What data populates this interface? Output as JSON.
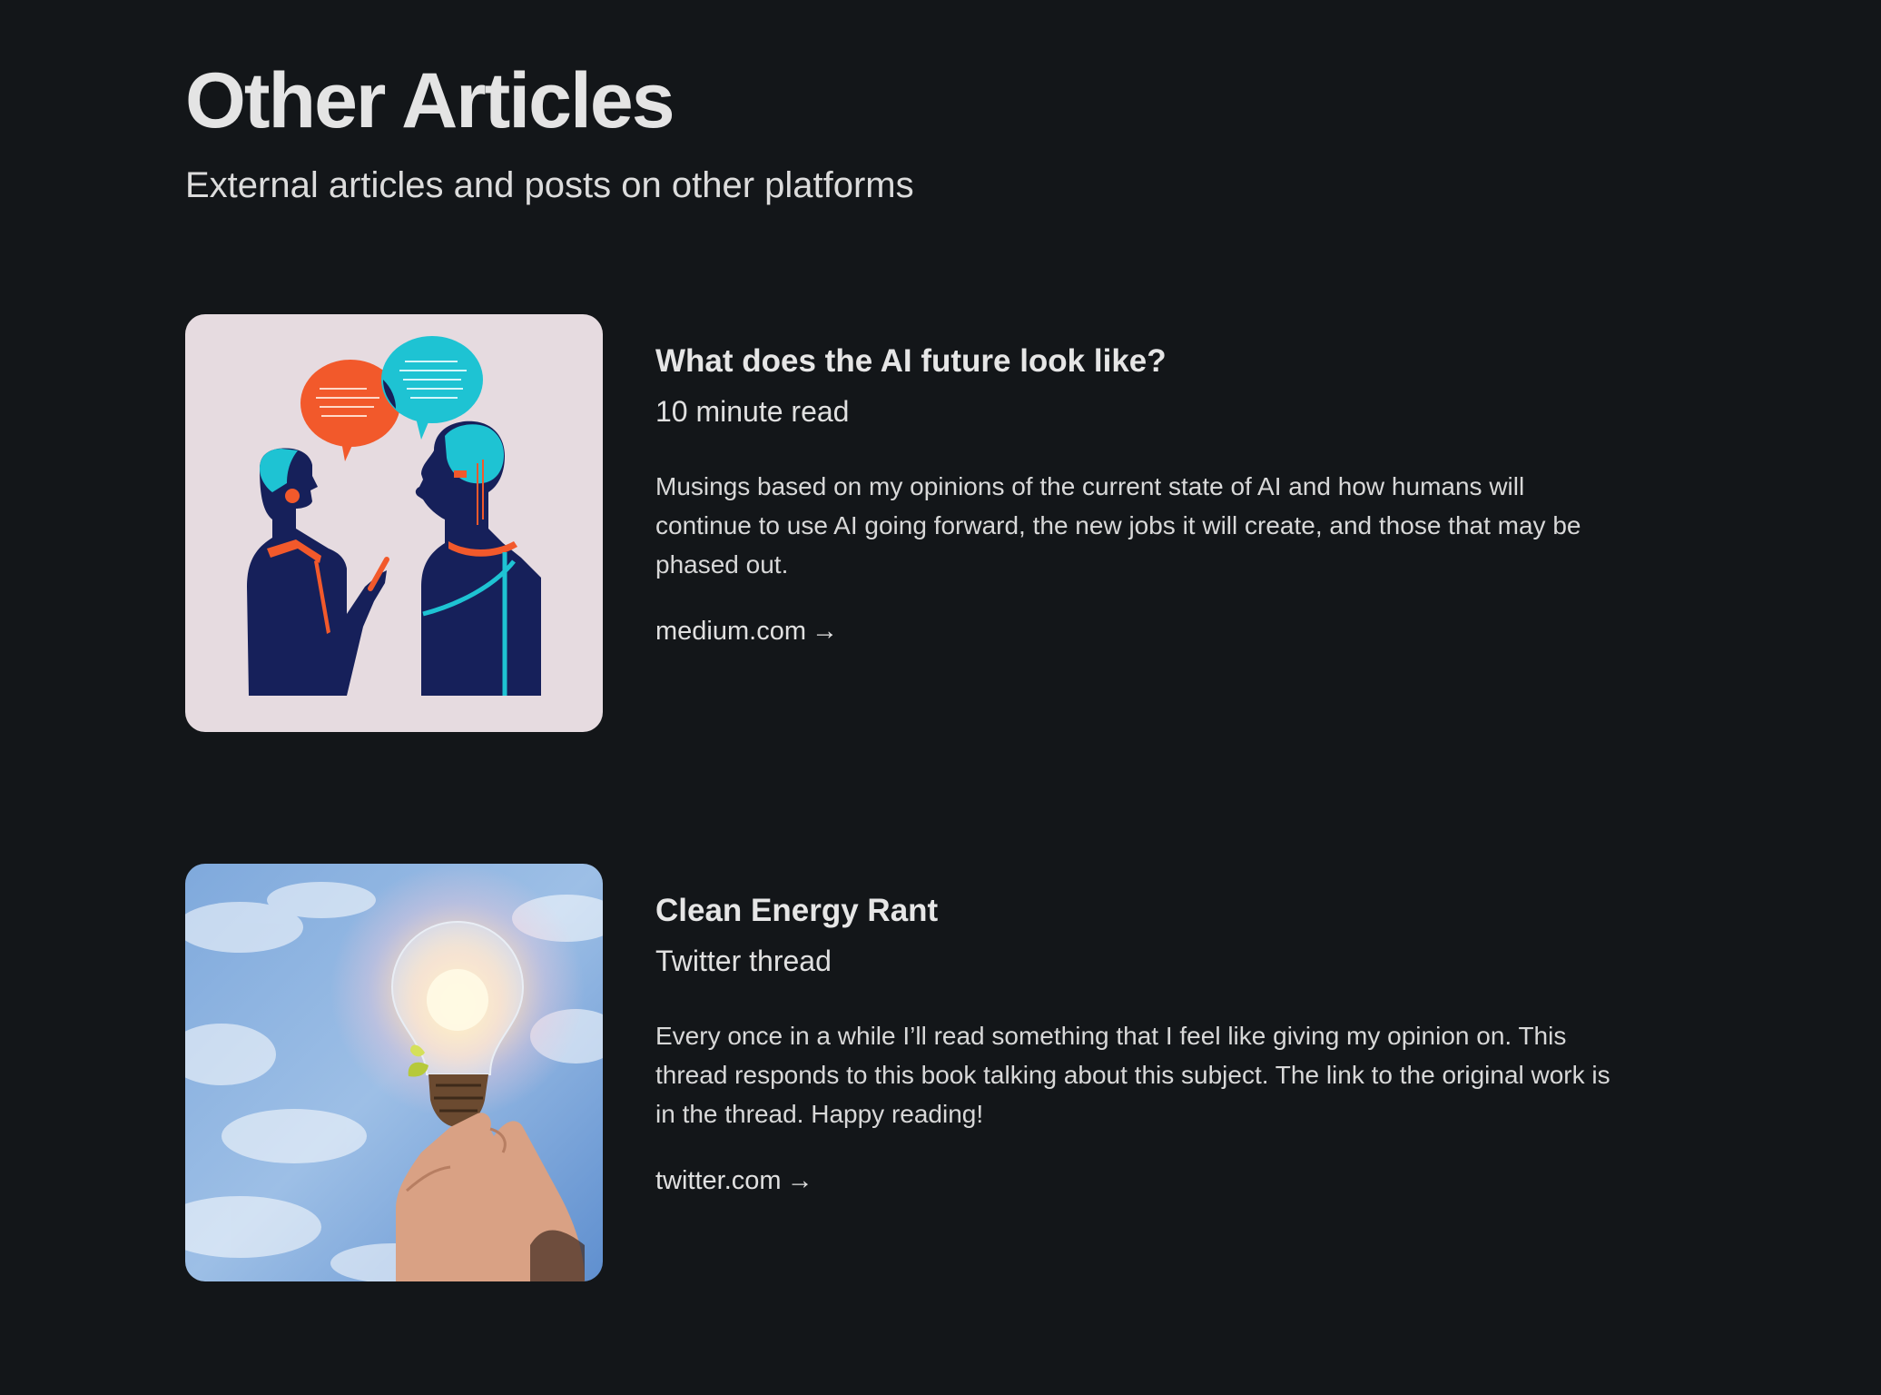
{
  "page": {
    "title": "Other Articles",
    "subtitle": "External articles and posts on other platforms"
  },
  "articles": [
    {
      "title": "What does the AI future look like?",
      "meta": "10 minute read",
      "description": "Musings based on my opinions of the current state of AI and how humans will continue to use AI going forward, the new jobs it will create, and those that may be phased out.",
      "link_text": "medium.com",
      "arrow": "→",
      "image": "ai-conversation-illustration"
    },
    {
      "title": "Clean Energy Rant",
      "meta": "Twitter thread",
      "description": "Every once in a while I’ll read something that I feel like giving my opinion on. This thread responds to this book talking about this subject. The link to the original work is in the thread. Happy reading!",
      "link_text": "twitter.com",
      "arrow": "→",
      "image": "lightbulb-in-hand-photo"
    }
  ],
  "colors": {
    "background": "#131619",
    "text": "#e6e6e6",
    "accent_orange": "#f2592b",
    "accent_cyan": "#1ec3d3",
    "navy": "#16205a"
  }
}
